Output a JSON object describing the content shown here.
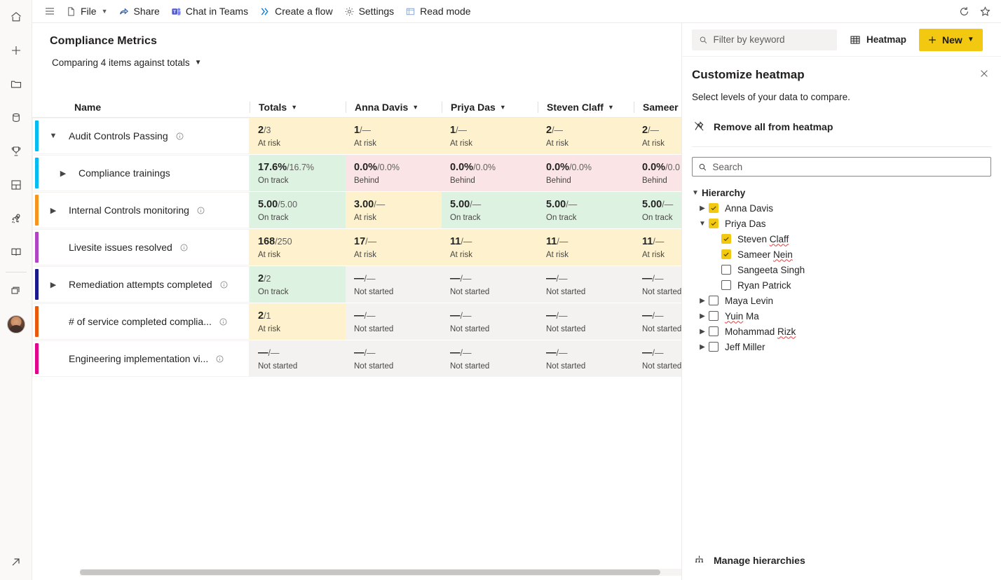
{
  "topbar": {
    "menu_icon": "hamburger-icon",
    "commands": [
      {
        "icon": "file-icon",
        "label": "File",
        "has_chevron": true
      },
      {
        "icon": "share-icon",
        "label": "Share",
        "has_chevron": false
      },
      {
        "icon": "teams-icon",
        "label": "Chat in Teams",
        "has_chevron": false
      },
      {
        "icon": "flow-icon",
        "label": "Create a flow",
        "has_chevron": false
      },
      {
        "icon": "gear-icon",
        "label": "Settings",
        "has_chevron": false
      },
      {
        "icon": "read-icon",
        "label": "Read mode",
        "has_chevron": false
      }
    ],
    "refresh_icon": "refresh-icon",
    "favorite_icon": "star-icon"
  },
  "rail": {
    "items": [
      "home-icon",
      "plus-icon",
      "folder-icon",
      "database-icon",
      "trophy-icon",
      "dashboard-icon",
      "rocket-icon",
      "book-icon"
    ],
    "secondary": [
      "copy-icon"
    ],
    "avatar": "user-avatar",
    "bottom": "expand-arrow-icon"
  },
  "main": {
    "title": "Compliance Metrics",
    "compare_label": "Comparing 4 items against totals"
  },
  "table": {
    "name_header": "Name",
    "columns": [
      {
        "label": "Totals",
        "misspelled": false
      },
      {
        "label": "Anna Davis",
        "misspelled": false
      },
      {
        "label": "Priya Das",
        "misspelled": false
      },
      {
        "label": "Steven Claff",
        "misspelled": true,
        "ok_part": "Steven ",
        "bad_part": "Claff"
      },
      {
        "label": "Sameer",
        "misspelled": false,
        "clipped": true
      }
    ],
    "rows": [
      {
        "label": "Audit Controls Passing",
        "accent": "#00bcf2",
        "indent": 0,
        "expander": "expanded",
        "has_info": true,
        "cells": [
          {
            "primary": "2",
            "secondary": "/3",
            "status": "At risk",
            "state": "atrisk"
          },
          {
            "primary": "1",
            "secondary": "/—",
            "status": "At risk",
            "state": "atrisk"
          },
          {
            "primary": "1",
            "secondary": "/—",
            "status": "At risk",
            "state": "atrisk"
          },
          {
            "primary": "2",
            "secondary": "/—",
            "status": "At risk",
            "state": "atrisk"
          },
          {
            "primary": "2",
            "secondary": "/—",
            "status": "At risk",
            "state": "atrisk"
          }
        ]
      },
      {
        "label": "Compliance trainings",
        "accent": "#00bcf2",
        "indent": 1,
        "expander": "collapsed",
        "has_info": false,
        "cells": [
          {
            "primary": "17.6%",
            "secondary": "/16.7%",
            "status": "On track",
            "state": "ontrack"
          },
          {
            "primary": "0.0%",
            "secondary": "/0.0%",
            "status": "Behind",
            "state": "behind"
          },
          {
            "primary": "0.0%",
            "secondary": "/0.0%",
            "status": "Behind",
            "state": "behind"
          },
          {
            "primary": "0.0%",
            "secondary": "/0.0%",
            "status": "Behind",
            "state": "behind"
          },
          {
            "primary": "0.0%",
            "secondary": "/0.0",
            "status": "Behind",
            "state": "behind"
          }
        ]
      },
      {
        "label": "Internal Controls monitoring",
        "accent": "#f7941d",
        "indent": 0,
        "expander": "collapsed",
        "has_info": true,
        "cells": [
          {
            "primary": "5.00",
            "secondary": "/5.00",
            "status": "On track",
            "state": "ontrack"
          },
          {
            "primary": "3.00",
            "secondary": "/—",
            "status": "At risk",
            "state": "atrisk"
          },
          {
            "primary": "5.00",
            "secondary": "/—",
            "status": "On track",
            "state": "ontrack"
          },
          {
            "primary": "5.00",
            "secondary": "/—",
            "status": "On track",
            "state": "ontrack"
          },
          {
            "primary": "5.00",
            "secondary": "/—",
            "status": "On track",
            "state": "ontrack"
          }
        ]
      },
      {
        "label": "Livesite issues resolved",
        "accent": "#b146c2",
        "indent": 0,
        "expander": "none",
        "has_info": true,
        "cells": [
          {
            "primary": "168",
            "secondary": "/250",
            "status": "At risk",
            "state": "atrisk"
          },
          {
            "primary": "17",
            "secondary": "/—",
            "status": "At risk",
            "state": "atrisk"
          },
          {
            "primary": "11",
            "secondary": "/—",
            "status": "At risk",
            "state": "atrisk"
          },
          {
            "primary": "11",
            "secondary": "/—",
            "status": "At risk",
            "state": "atrisk"
          },
          {
            "primary": "11",
            "secondary": "/—",
            "status": "At risk",
            "state": "atrisk"
          }
        ]
      },
      {
        "label": "Remediation attempts completed",
        "accent": "#1a1a8c",
        "indent": 0,
        "expander": "collapsed",
        "has_info": true,
        "cells": [
          {
            "primary": "2",
            "secondary": "/2",
            "status": "On track",
            "state": "ontrack"
          },
          {
            "primary": "—",
            "secondary": "/—",
            "status": "Not started",
            "state": "none"
          },
          {
            "primary": "—",
            "secondary": "/—",
            "status": "Not started",
            "state": "none"
          },
          {
            "primary": "—",
            "secondary": "/—",
            "status": "Not started",
            "state": "none"
          },
          {
            "primary": "—",
            "secondary": "/—",
            "status": "Not started",
            "state": "none"
          }
        ]
      },
      {
        "label": "# of service completed complia...",
        "accent": "#e8590c",
        "indent": 0,
        "expander": "none",
        "has_info": true,
        "cells": [
          {
            "primary": "2",
            "secondary": "/1",
            "status": "At risk",
            "state": "atrisk"
          },
          {
            "primary": "—",
            "secondary": "/—",
            "status": "Not started",
            "state": "none"
          },
          {
            "primary": "—",
            "secondary": "/—",
            "status": "Not started",
            "state": "none"
          },
          {
            "primary": "—",
            "secondary": "/—",
            "status": "Not started",
            "state": "none"
          },
          {
            "primary": "—",
            "secondary": "/—",
            "status": "Not started",
            "state": "none"
          }
        ]
      },
      {
        "label": "Engineering implementation vi...",
        "accent": "#e3008c",
        "indent": 0,
        "expander": "none",
        "has_info": true,
        "cells": [
          {
            "primary": "—",
            "secondary": "/—",
            "status": "Not started",
            "state": "none"
          },
          {
            "primary": "—",
            "secondary": "/—",
            "status": "Not started",
            "state": "none"
          },
          {
            "primary": "—",
            "secondary": "/—",
            "status": "Not started",
            "state": "none"
          },
          {
            "primary": "—",
            "secondary": "/—",
            "status": "Not started",
            "state": "none"
          },
          {
            "primary": "—",
            "secondary": "/—",
            "status": "Not started",
            "state": "none"
          }
        ]
      }
    ]
  },
  "panel": {
    "filter_placeholder": "Filter by keyword",
    "filter_value": "",
    "heatmap_label": "Heatmap",
    "new_label": "New",
    "title": "Customize heatmap",
    "subtitle": "Select levels of your data to compare.",
    "remove_all_label": "Remove all from heatmap",
    "search_placeholder": "Search",
    "search_value": "",
    "tree_root": "Hierarchy",
    "tree": [
      {
        "label": "Anna Davis",
        "depth": 1,
        "expander": "collapsed",
        "checked": true,
        "misspelled": false
      },
      {
        "label": "Priya Das",
        "depth": 1,
        "expander": "expanded",
        "checked": true,
        "misspelled": false
      },
      {
        "label": "Steven Claff",
        "depth": 2,
        "expander": "none",
        "checked": true,
        "misspelled": true,
        "ok_part": "Steven ",
        "bad_part": "Claff"
      },
      {
        "label": "Sameer Nein",
        "depth": 2,
        "expander": "none",
        "checked": true,
        "misspelled": true,
        "ok_part": "Sameer ",
        "bad_part": "Nein"
      },
      {
        "label": "Sangeeta Singh",
        "depth": 2,
        "expander": "none",
        "checked": false,
        "misspelled": false
      },
      {
        "label": "Ryan Patrick",
        "depth": 2,
        "expander": "none",
        "checked": false,
        "misspelled": false
      },
      {
        "label": "Maya Levin",
        "depth": 1,
        "expander": "collapsed",
        "checked": false,
        "misspelled": false
      },
      {
        "label": "Yuin Ma",
        "depth": 1,
        "expander": "collapsed",
        "checked": false,
        "misspelled": true,
        "ok_part": "",
        "bad_part": "Yuin",
        "tail": " Ma"
      },
      {
        "label": "Mohammad Rizk",
        "depth": 1,
        "expander": "collapsed",
        "checked": false,
        "misspelled": true,
        "ok_part": "Mohammad ",
        "bad_part": "Rizk"
      },
      {
        "label": "Jeff Miller",
        "depth": 1,
        "expander": "collapsed",
        "checked": false,
        "misspelled": false
      }
    ],
    "manage_label": "Manage hierarchies"
  },
  "colors": {
    "brand_yellow": "#f2c811",
    "at_risk_bg": "#fdf2cd",
    "behind_bg": "#fbe4e6",
    "on_track_bg": "#ddf2e0",
    "not_started_bg": "#f3f2f1"
  }
}
